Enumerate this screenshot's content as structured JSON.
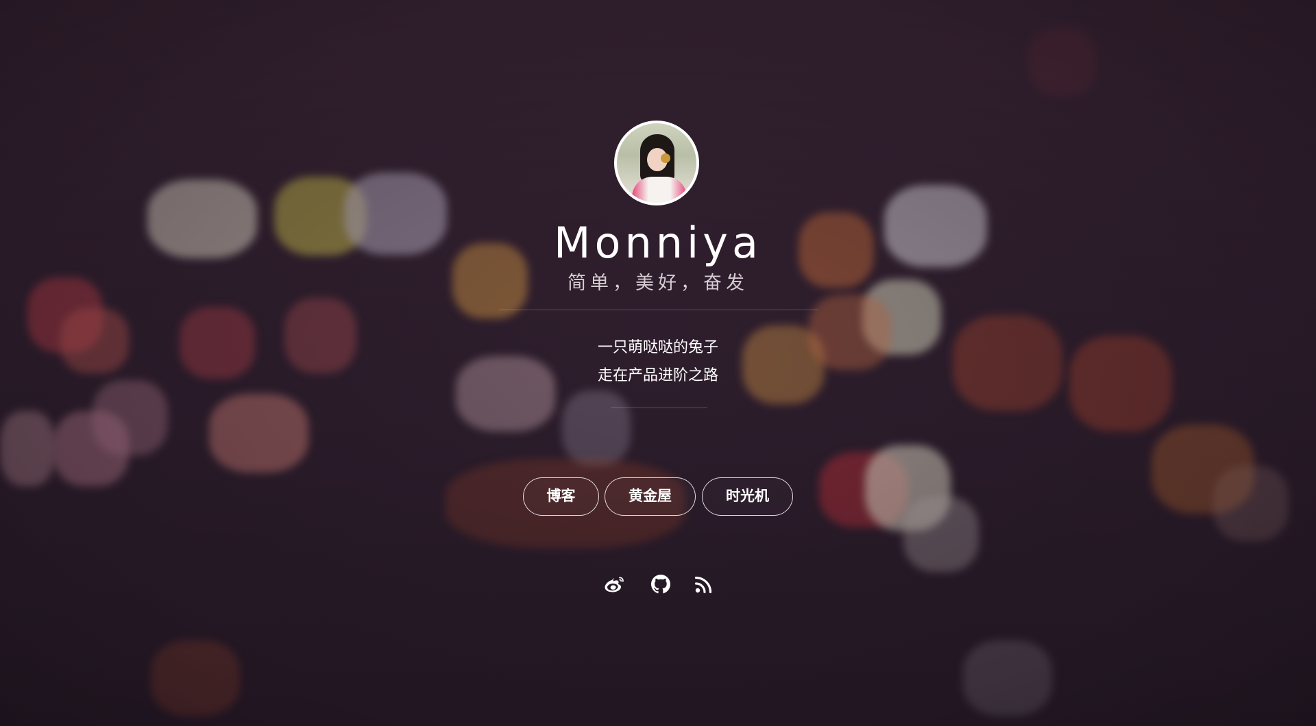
{
  "profile": {
    "name": "Monniya",
    "tagline": "简单，美好，奋发",
    "bio_line1": "一只萌哒哒的兔子",
    "bio_line2": "走在产品进阶之路"
  },
  "nav": {
    "items": [
      {
        "label": "博客"
      },
      {
        "label": "黄金屋"
      },
      {
        "label": "时光机"
      }
    ]
  },
  "social": {
    "icons": [
      "weibo-icon",
      "github-icon",
      "rss-icon"
    ]
  },
  "colors": {
    "background": "#2f1f2e",
    "text": "#ffffff",
    "subtitle": "#d7cdd3"
  }
}
